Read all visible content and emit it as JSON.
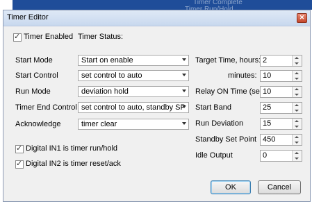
{
  "background": {
    "text1": "Timer Complete",
    "text2": "Timer Run/Hold"
  },
  "dialog": {
    "title": "Timer Editor"
  },
  "timer_enabled": {
    "label": "Timer Enabled",
    "checked": true
  },
  "timer_status": {
    "label": "Timer Status:"
  },
  "start_mode": {
    "label": "Start Mode",
    "value": "Start on enable"
  },
  "start_control": {
    "label": "Start Control",
    "value": "set control to auto"
  },
  "run_mode": {
    "label": "Run Mode",
    "value": "deviation hold"
  },
  "timer_end_control": {
    "label": "Timer End Control",
    "value": "set control to auto, standby SP"
  },
  "acknowledge": {
    "label": "Acknowledge",
    "value": "timer clear"
  },
  "digital_in1": {
    "label": "Digital IN1 is timer run/hold",
    "checked": true
  },
  "digital_in2": {
    "label": "Digital IN2 is timer reset/ack",
    "checked": true
  },
  "target_hours": {
    "label": "Target Time, hours:",
    "value": "2"
  },
  "target_minutes": {
    "label": "minutes:",
    "value": "10"
  },
  "relay_on_time": {
    "label": "Relay ON Time (sec)",
    "value": "10"
  },
  "start_band": {
    "label": "Start Band",
    "value": "25"
  },
  "run_deviation": {
    "label": "Run Deviation",
    "value": "15"
  },
  "standby_set_point": {
    "label": "Standby Set Point",
    "value": "450"
  },
  "idle_output": {
    "label": "Idle Output",
    "value": "0"
  },
  "buttons": {
    "ok": "OK",
    "cancel": "Cancel"
  }
}
